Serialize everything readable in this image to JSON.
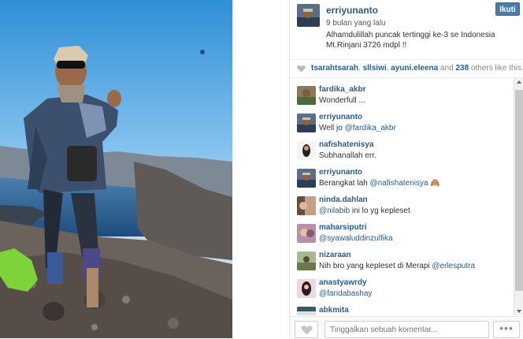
{
  "photo": {
    "description_icon": "summit-photo"
  },
  "post": {
    "owner": "erriyunanto",
    "time": "9 bulan yang lalu",
    "caption_line1": "Alhamdulillah puncak tertinggi ke-3 se Indonesia",
    "caption_line2": "Mt.Rinjani 3726 mdpl !!",
    "follow_label": "Ikuti"
  },
  "likes": {
    "users": [
      "tsarahtsarah",
      "sllsiwi",
      "ayuni.eleena"
    ],
    "count": "238",
    "suffix": "others like this."
  },
  "comments": [
    {
      "user": "fardika_akbr",
      "text": "Wonderfull ...",
      "mention": ""
    },
    {
      "user": "erriyunanto",
      "text": "Well jo ",
      "mention": "@fardika_akbr"
    },
    {
      "user": "nafishatenisya",
      "text": "Subhanallah err.",
      "mention": ""
    },
    {
      "user": "erriyunanto",
      "text": "Berangkat lah ",
      "mention": "@nafishatenisya",
      "tail": " 🙈"
    },
    {
      "user": "ninda.dahlan",
      "text": "",
      "mention": "@nilabib",
      "tail": " ini lo yg kepleset"
    },
    {
      "user": "maharsiputri",
      "text": "",
      "mention": "@syawaluddinzulfika"
    },
    {
      "user": "nizaraan",
      "text": "Nih bro yang kepleset di Merapi ",
      "mention": "@erlesputra"
    },
    {
      "user": "anastyawrdy",
      "text": "",
      "mention": "@faridabashay"
    },
    {
      "user": "abkmita",
      "text": "",
      "mention": ""
    }
  ],
  "footer": {
    "placeholder": "Tinggalkan sebuah komentar...",
    "more_label": "•••"
  },
  "colors": {
    "link": "#2a5c8a",
    "follow": "#4a7cab"
  }
}
